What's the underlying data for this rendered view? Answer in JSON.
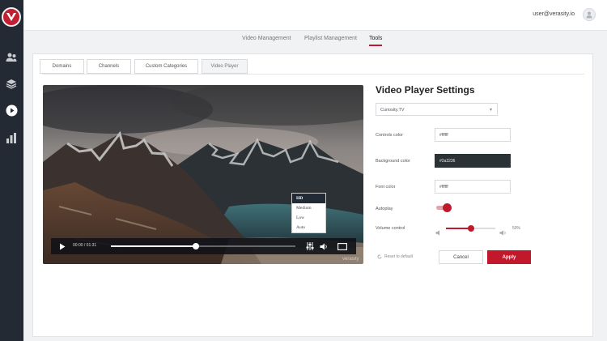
{
  "user": {
    "email": "user@verasity.io"
  },
  "main_nav": [
    {
      "label": "Video Management",
      "active": false
    },
    {
      "label": "Playlist Management",
      "active": false
    },
    {
      "label": "Tools",
      "active": true
    }
  ],
  "tabs": [
    {
      "label": "Domains",
      "active": false
    },
    {
      "label": "Channels",
      "active": false
    },
    {
      "label": "Custom Categories",
      "active": false
    },
    {
      "label": "Video Player",
      "active": true
    }
  ],
  "player": {
    "time": "00:00 / 01:31",
    "progress_fraction": 0.46,
    "watermark": "verasity",
    "quality_options": [
      "HD",
      "Medium",
      "Low",
      "Auto"
    ],
    "quality_selected": "HD"
  },
  "settings": {
    "title": "Video Player Settings",
    "channel_selected": "Curiosity.TV",
    "controls_color_label": "Controls color",
    "controls_color_value": "#ffffff",
    "background_color_label": "Background color",
    "background_color_value": "#2a3236",
    "font_color_label": "Font color",
    "font_color_value": "#ffffff",
    "autoplay_label": "Autoplay",
    "autoplay_on": true,
    "volume_label": "Volume control",
    "volume_fraction": 0.5,
    "volume_text": "50%",
    "reset_label": "Reset to default",
    "cancel_label": "Cancel",
    "apply_label": "Apply"
  },
  "colors": {
    "accent": "#c2182b",
    "sidebar": "#232a34",
    "player_bar": "#0f1218"
  },
  "icons": {
    "sidebar": [
      "users-icon",
      "layers-icon",
      "play-circle-icon",
      "bar-chart-icon"
    ],
    "player": [
      "play-icon",
      "equalizer-icon",
      "volume-icon",
      "fullscreen-icon"
    ]
  }
}
